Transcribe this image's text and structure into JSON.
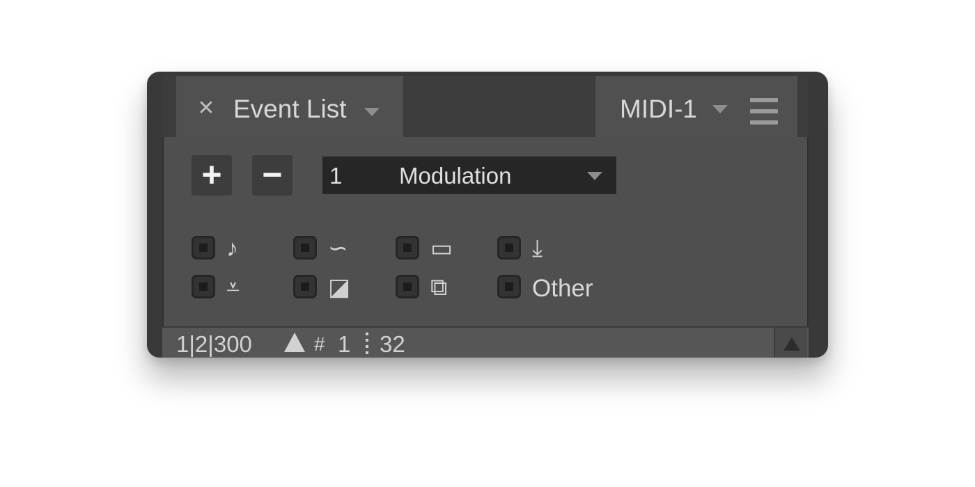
{
  "tab": {
    "close_glyph": "✕",
    "title": "Event List"
  },
  "header_right": {
    "track_label": "MIDI-1"
  },
  "toolbar": {
    "add_glyph": "+",
    "remove_glyph": "−",
    "select": {
      "number": "1",
      "value": "Modulation"
    }
  },
  "filters": [
    {
      "icon": "note-icon",
      "glyph": "♪"
    },
    {
      "icon": "curve-icon",
      "glyph": "∽"
    },
    {
      "icon": "bar-icon",
      "glyph": "▭"
    },
    {
      "icon": "download-icon",
      "glyph": "⤓"
    },
    {
      "icon": "double-down-icon",
      "glyph": "⩡"
    },
    {
      "icon": "slash-box-icon",
      "glyph": "◪"
    },
    {
      "icon": "overlap-squares-icon",
      "glyph": "⧉"
    },
    {
      "icon": "",
      "label": "Other"
    }
  ],
  "status": {
    "position": "1|2|300",
    "channel": "1",
    "value": "32"
  },
  "colors": {
    "panel": "#4f4f4f",
    "tab": "#505050",
    "frame": "#393939",
    "select_bg": "#262626",
    "text": "#d8d8d8"
  }
}
